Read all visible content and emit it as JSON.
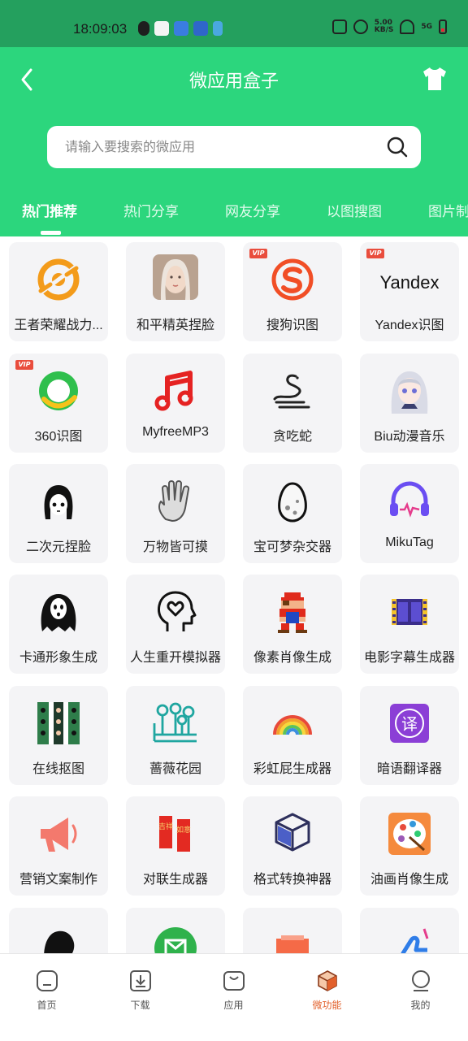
{
  "status_bar": {
    "time": "18:09:03",
    "net_speed": "5.00",
    "net_unit": "KB/S",
    "signal_label": "5G"
  },
  "header": {
    "title": "微应用盒子"
  },
  "search": {
    "placeholder": "请输入要搜索的微应用"
  },
  "tabs": [
    "热门推荐",
    "热门分享",
    "网友分享",
    "以图搜图",
    "图片制"
  ],
  "apps": [
    {
      "label": "王者荣耀战力...",
      "icon": "target-orange-icon",
      "vip": ""
    },
    {
      "label": "和平精英捏脸",
      "icon": "avatar-girl-icon",
      "vip": ""
    },
    {
      "label": "搜狗识图",
      "icon": "sogou-icon",
      "vip": "VIP"
    },
    {
      "label": "Yandex识图",
      "icon": "yandex-icon",
      "vip": "VIP",
      "logo_text": "Yandex"
    },
    {
      "label": "360识图",
      "icon": "360-icon",
      "vip": "VIP"
    },
    {
      "label": "MyfreeMP3",
      "icon": "music-note-icon",
      "vip": ""
    },
    {
      "label": "贪吃蛇",
      "icon": "snake-icon",
      "vip": ""
    },
    {
      "label": "Biu动漫音乐",
      "icon": "anime-girl-icon",
      "vip": ""
    },
    {
      "label": "二次元捏脸",
      "icon": "anime-face-icon",
      "vip": ""
    },
    {
      "label": "万物皆可摸",
      "icon": "hand-icon",
      "vip": ""
    },
    {
      "label": "宝可梦杂交器",
      "icon": "egg-icon",
      "vip": ""
    },
    {
      "label": "MikuTag",
      "icon": "headphones-icon",
      "vip": ""
    },
    {
      "label": "卡通形象生成",
      "icon": "ghost-mask-icon",
      "vip": ""
    },
    {
      "label": "人生重开模拟器",
      "icon": "head-heart-icon",
      "vip": ""
    },
    {
      "label": "像素肖像生成",
      "icon": "pixel-mario-icon",
      "vip": ""
    },
    {
      "label": "电影字幕生成器",
      "icon": "film-strip-icon",
      "vip": ""
    },
    {
      "label": "在线抠图",
      "icon": "cutout-grid-icon",
      "vip": ""
    },
    {
      "label": "蔷薇花园",
      "icon": "garden-icon",
      "vip": ""
    },
    {
      "label": "彩虹屁生成器",
      "icon": "rainbow-icon",
      "vip": ""
    },
    {
      "label": "暗语翻译器",
      "icon": "translate-icon",
      "vip": "",
      "logo_text": "译"
    },
    {
      "label": "营销文案制作",
      "icon": "megaphone-icon",
      "vip": ""
    },
    {
      "label": "对联生成器",
      "icon": "couplet-icon",
      "vip": "",
      "logo_text_left": "吉祥",
      "logo_text_right": "如意"
    },
    {
      "label": "格式转换神器",
      "icon": "cube-convert-icon",
      "vip": ""
    },
    {
      "label": "油画肖像生成",
      "icon": "palette-icon",
      "vip": ""
    },
    {
      "label": "",
      "icon": "silhouette-icon",
      "vip": ""
    },
    {
      "label": "",
      "icon": "mail-icon",
      "vip": ""
    },
    {
      "label": "",
      "icon": "image-icon",
      "vip": ""
    },
    {
      "label": "",
      "icon": "thumbs-up-icon",
      "vip": ""
    }
  ],
  "bottom_nav": [
    {
      "label": "首页",
      "icon": "home-icon"
    },
    {
      "label": "下载",
      "icon": "download-icon"
    },
    {
      "label": "应用",
      "icon": "bag-icon"
    },
    {
      "label": "微功能",
      "icon": "box-icon",
      "active": true
    },
    {
      "label": "我的",
      "icon": "profile-icon"
    }
  ],
  "colors": {
    "primary": "#2cd67d",
    "statusbar": "#24a05e",
    "active_nav": "#e2602b",
    "vip": "#e94d3d"
  }
}
